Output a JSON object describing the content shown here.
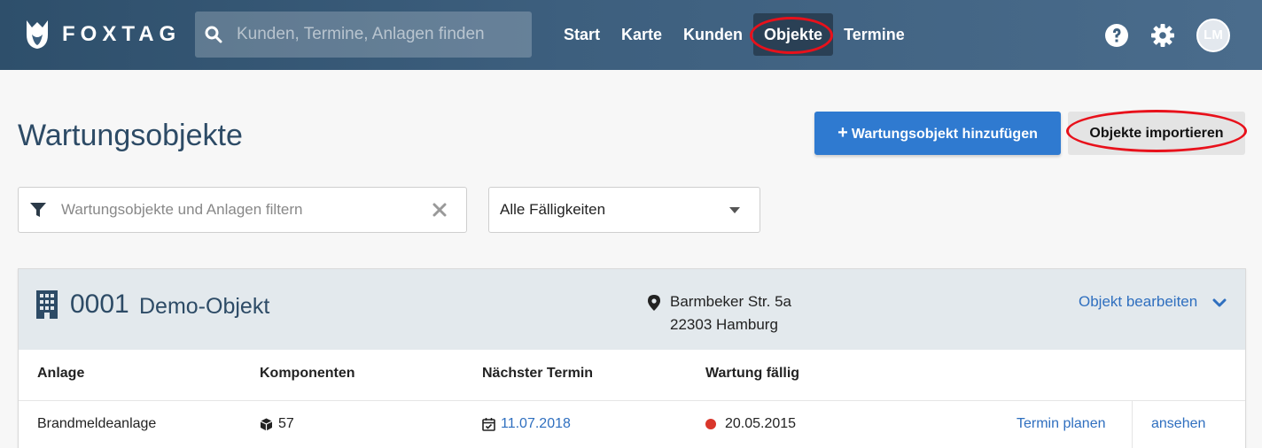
{
  "header": {
    "brand": "FOXTAG",
    "search_placeholder": "Kunden, Termine, Anlagen finden",
    "nav": [
      {
        "label": "Start"
      },
      {
        "label": "Karte"
      },
      {
        "label": "Kunden"
      },
      {
        "label": "Objekte",
        "active": true
      },
      {
        "label": "Termine"
      }
    ],
    "avatar_initials": "LM"
  },
  "page": {
    "title": "Wartungsobjekte",
    "add_button": "Wartungsobjekt hinzufügen",
    "import_button": "Objekte importieren"
  },
  "filters": {
    "filter_placeholder": "Wartungsobjekte und Anlagen filtern",
    "due_select_value": "Alle Fälligkeiten"
  },
  "object": {
    "number": "0001",
    "name": "Demo-Objekt",
    "address_line1": "Barmbeker Str. 5a",
    "address_line2": "22303 Hamburg",
    "edit_label": "Objekt bearbeiten",
    "columns": [
      "Anlage",
      "Komponenten",
      "Nächster Termin",
      "Wartung fällig"
    ],
    "rows": [
      {
        "anlage": "Brandmeldeanlage",
        "komponenten": "57",
        "naechster_termin": "11.07.2018",
        "wartung_faellig": "20.05.2015",
        "action_plan": "Termin planen",
        "action_view": "ansehen"
      }
    ]
  },
  "colors": {
    "header_bg": "#3d5f7e",
    "primary": "#2f7ad0",
    "link": "#2f6fbf",
    "status_overdue": "#d9362b",
    "annotation_red": "#e8111b"
  }
}
